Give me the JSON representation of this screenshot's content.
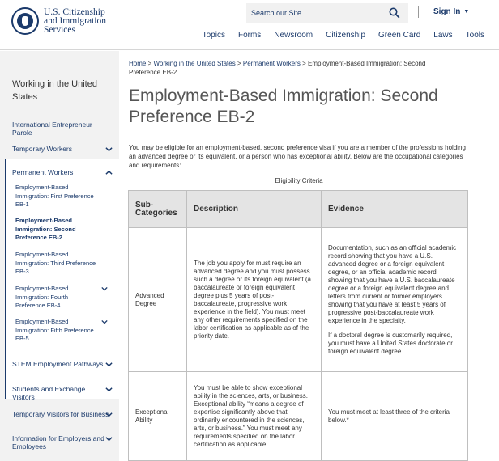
{
  "header": {
    "logo_text": [
      "U.S. Citizenship",
      "and Immigration",
      "Services"
    ],
    "search_placeholder": "Search our Site",
    "signin": "Sign In",
    "nav": [
      "Topics",
      "Forms",
      "Newsroom",
      "Citizenship",
      "Green Card",
      "Laws",
      "Tools"
    ]
  },
  "sidebar": {
    "title": "Working in the United States",
    "items": [
      {
        "label": "International Entrepreneur Parole"
      },
      {
        "label": "Temporary Workers"
      },
      {
        "label": "Permanent Workers"
      },
      {
        "label": "STEM Employment Pathways"
      },
      {
        "label": "Students and Exchange Visitors"
      },
      {
        "label": "Temporary Visitors for Business"
      },
      {
        "label": "Information for Employers and Employees"
      }
    ],
    "subitems": [
      {
        "label": "Employment-Based Immigration: First Preference EB-1"
      },
      {
        "label": "Employment-Based Immigration: Second Preference EB-2"
      },
      {
        "label": "Employment-Based Immigration: Third Preference EB-3"
      },
      {
        "label": "Employment-Based Immigration: Fourth Preference EB-4"
      },
      {
        "label": "Employment-Based Immigration: Fifth Preference EB-5"
      }
    ]
  },
  "breadcrumb": {
    "home": "Home",
    "sep": ">",
    "working": "Working in the United States",
    "permanent": "Permanent Workers",
    "current": "Employment-Based Immigration: Second Preference EB-2"
  },
  "page_title": "Employment-Based Immigration: Second Preference EB-2",
  "intro": "You may be eligible for an employment-based, second preference visa if you are a member of the professions holding an advanced degree or its equivalent, or a person who has exceptional ability. Below are the occupational categories and requirements:",
  "table": {
    "caption": "Eligibility Criteria",
    "headers": [
      "Sub-Categories",
      "Description",
      "Evidence"
    ],
    "rows": [
      {
        "category": "Advanced Degree",
        "description": "The job you apply for must require an advanced degree and you must possess such a degree or its foreign equivalent (a baccalaureate or foreign equivalent degree plus 5 years of post-baccalaureate, progressive work experience in the field). You must meet any other requirements specified on the labor certification as applicable as of the priority date.",
        "evidence_1": "Documentation, such as an official academic record showing that you have a U.S. advanced degree or a foreign equivalent degree, or an official academic record showing that you have a U.S. baccalaureate degree or a foreign equivalent degree and letters from current or former employers showing that you have at least 5 years of progressive post-baccalaureate work experience in the specialty.",
        "evidence_2": "If a doctoral degree is customarily required, you must have a United States doctorate or foreign equivalent degree"
      },
      {
        "category": "Exceptional Ability",
        "description": "You must be able to show exceptional ability in the sciences, arts, or business. Exceptional ability “means a degree of expertise significantly above that ordinarily encountered in the sciences, arts, or business.” You must meet any requirements specified on the labor certification as applicable.",
        "evidence_1": "You must meet at least three of the criteria below.*"
      }
    ]
  },
  "colors": {
    "brand": "#1b3a6b",
    "sidebar_bg": "#f2f2f2",
    "table_header_bg": "#e4e4e4"
  }
}
